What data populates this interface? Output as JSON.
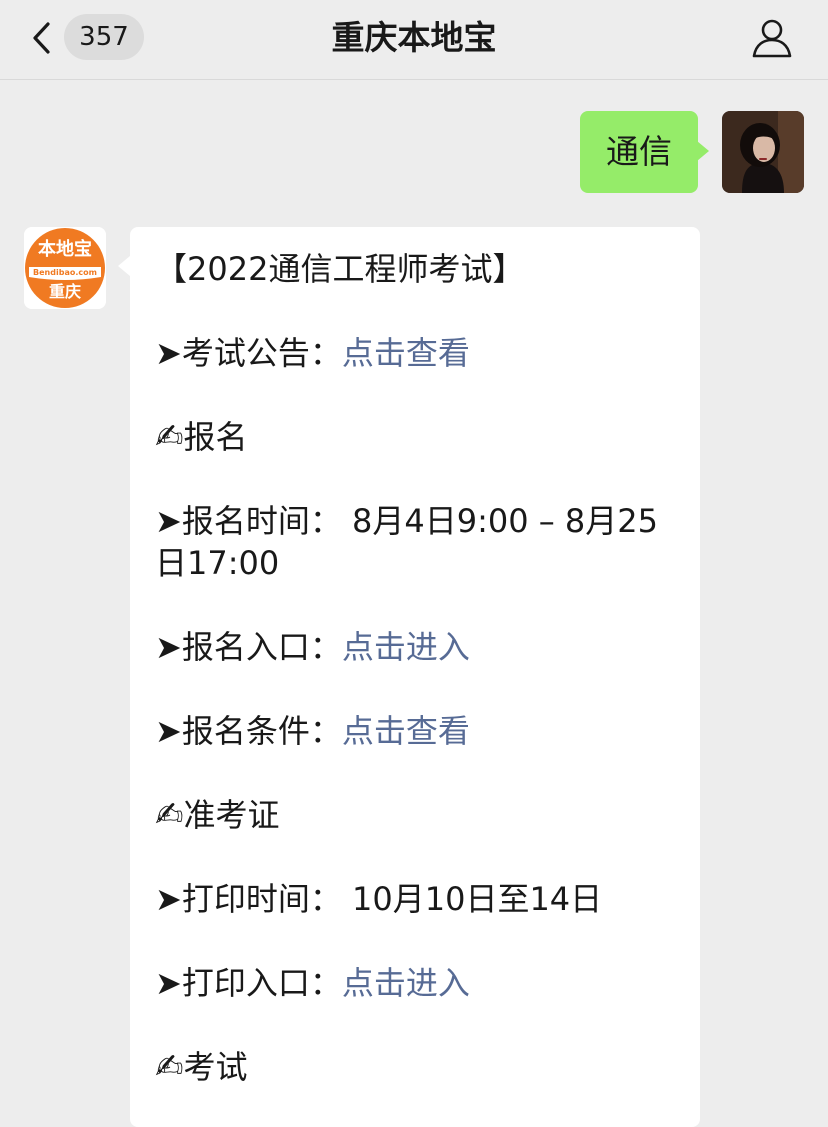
{
  "nav": {
    "unread_count": "357",
    "title": "重庆本地宝"
  },
  "outgoing": {
    "text": "通信"
  },
  "account_logo": {
    "brand": "本地宝",
    "site": "Bendibao.com",
    "city": "重庆"
  },
  "message": {
    "heading": "【2022通信工程师考试】",
    "lines": [
      {
        "prefix": "➤",
        "label": "考试公告：",
        "link": "点击查看"
      },
      {
        "icon": "✍",
        "text": "报名"
      },
      {
        "prefix": "➤",
        "label": "报名时间：",
        "text": " 8月4日9:00 – 8月25日17:00"
      },
      {
        "prefix": "➤",
        "label": "报名入口：",
        "link": "点击进入"
      },
      {
        "prefix": "➤",
        "label": "报名条件：",
        "link": "点击查看"
      },
      {
        "icon": "✍",
        "text": "准考证"
      },
      {
        "prefix": "➤",
        "label": "打印时间：",
        "text": " 10月10日至14日"
      },
      {
        "prefix": "➤",
        "label": "打印入口：",
        "link": "点击进入"
      },
      {
        "icon": "✍",
        "text": "考试"
      }
    ]
  },
  "colors": {
    "background": "#ededed",
    "outgoing_bubble": "#95ec69",
    "link": "#576b95",
    "logo_orange": "#f07a22"
  }
}
